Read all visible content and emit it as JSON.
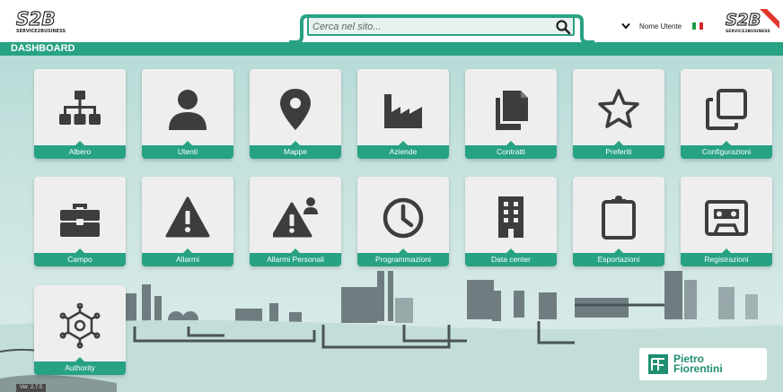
{
  "header": {
    "logo_left": "S2B",
    "logo_left_sub": "SERVICE2BUSINESS",
    "logo_right": "S2B",
    "logo_right_sub": "SERVICE2BUSINESS",
    "search_placeholder": "Cerca nel sito...",
    "user_name": "Nome Utente",
    "language_flag": "flag-it"
  },
  "dashboard": {
    "title": "DASHBOARD"
  },
  "tiles": [
    {
      "label": "Albero",
      "icon": "hierarchy-icon"
    },
    {
      "label": "Utenti",
      "icon": "user-icon"
    },
    {
      "label": "Mappe",
      "icon": "map-pin-icon"
    },
    {
      "label": "Aziende",
      "icon": "factory-icon"
    },
    {
      "label": "Contratti",
      "icon": "documents-icon"
    },
    {
      "label": "Preferiti",
      "icon": "star-icon"
    },
    {
      "label": "Configurazioni",
      "icon": "copy-icon"
    },
    {
      "label": "Campo",
      "icon": "toolbox-icon"
    },
    {
      "label": "Allarmi",
      "icon": "warning-icon"
    },
    {
      "label": "Allarmi Personali",
      "icon": "personal-warning-icon"
    },
    {
      "label": "Programmazioni",
      "icon": "clock-icon"
    },
    {
      "label": "Data center",
      "icon": "building-icon"
    },
    {
      "label": "Esportazioni",
      "icon": "clipboard-icon"
    },
    {
      "label": "Registrazioni",
      "icon": "cassette-icon"
    },
    {
      "label": "Authority",
      "icon": "network-gear-icon"
    }
  ],
  "footer": {
    "version": "Ver. 2.7.5",
    "brand_line1": "Pietro",
    "brand_line2": "Fiorentini"
  },
  "colors": {
    "accent": "#27a283",
    "tile_bg": "#eeeeee",
    "icon": "#3d3d3d"
  }
}
